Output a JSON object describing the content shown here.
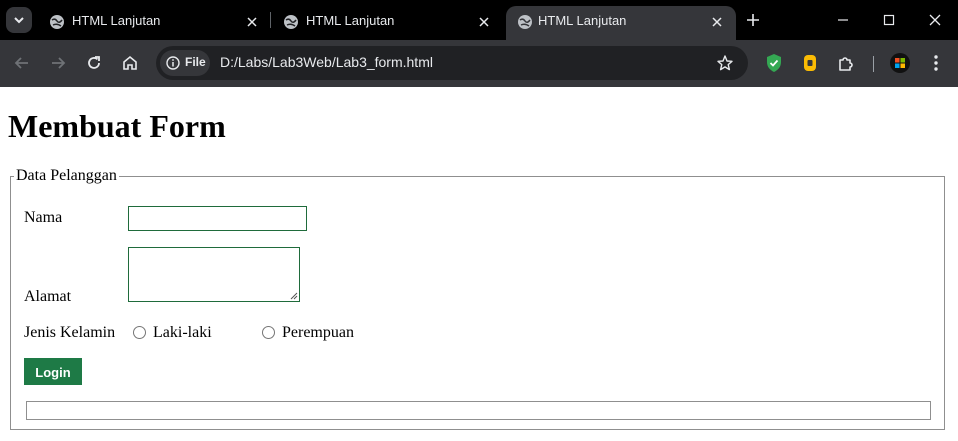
{
  "browser": {
    "tabs": [
      {
        "title": "HTML Lanjutan",
        "active": false
      },
      {
        "title": "HTML Lanjutan",
        "active": false
      },
      {
        "title": "HTML Lanjutan",
        "active": true
      }
    ],
    "address": {
      "chip_label": "File",
      "url": "D:/Labs/Lab3Web/Lab3_form.html"
    },
    "colors": {
      "tabstrip": "#000000",
      "toolbar": "#35363a",
      "omnibox": "#202124"
    }
  },
  "page": {
    "heading": "Membuat Form",
    "fieldset": {
      "legend": "Data Pelanggan",
      "nama_label": "Nama",
      "nama_value": "",
      "alamat_label": "Alamat",
      "alamat_value": "",
      "gender_label": "Jenis Kelamin",
      "gender_options": [
        "Laki-laki",
        "Perempuan"
      ],
      "submit_label": "Login",
      "output_value": ""
    },
    "colors": {
      "button": "#1e7a46",
      "input_border": "#1f6b3b"
    }
  }
}
